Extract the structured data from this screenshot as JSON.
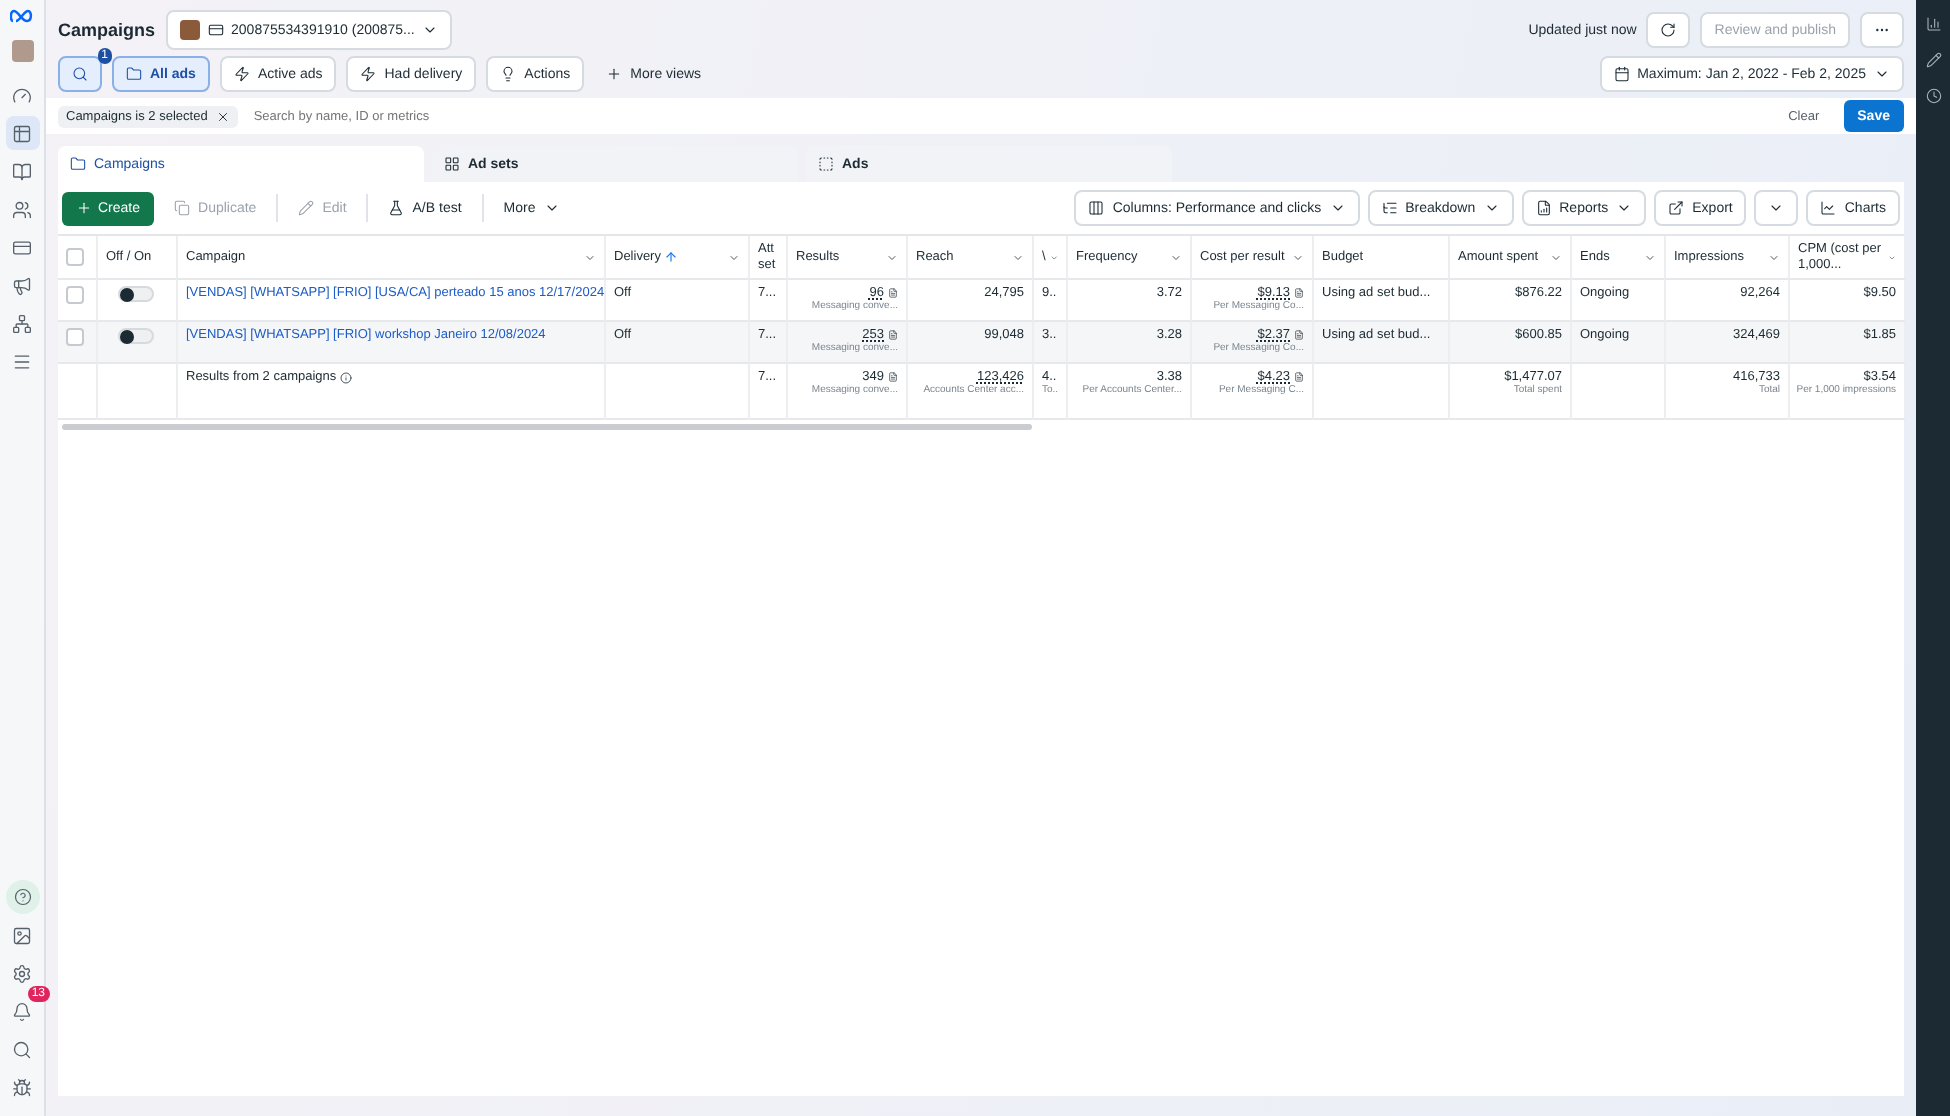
{
  "nav": {
    "items": [
      {
        "selected": false
      },
      {
        "selected": true
      },
      {
        "selected": false
      },
      {
        "selected": false
      },
      {
        "selected": false
      },
      {
        "selected": false
      },
      {
        "selected": false
      },
      {
        "selected": false
      }
    ],
    "notification_count": "13"
  },
  "header": {
    "title": "Campaigns",
    "account": "200875534391910 (200875...",
    "updated": "Updated just now",
    "review_button": "Review and publish",
    "date_range": "Maximum: Jan 2, 2022 - Feb 2, 2025"
  },
  "views": {
    "search_badge": "1",
    "items": [
      {
        "label": "All ads",
        "selected": true
      },
      {
        "label": "Active ads",
        "selected": false
      },
      {
        "label": "Had delivery",
        "selected": false
      },
      {
        "label": "Actions",
        "selected": false
      }
    ],
    "more_views": "More views"
  },
  "filter": {
    "chip": "Campaigns is 2 selected",
    "placeholder": "Search by name, ID or metrics",
    "clear": "Clear",
    "save": "Save"
  },
  "level_tabs": [
    {
      "label": "Campaigns",
      "selected": true
    },
    {
      "label": "Ad sets",
      "selected": false
    },
    {
      "label": "Ads",
      "selected": false
    }
  ],
  "toolbar": {
    "create": "Create",
    "duplicate": {
      "label": "Duplicate",
      "disabled": true
    },
    "edit": {
      "label": "Edit",
      "disabled": true
    },
    "ab_test": "A/B test",
    "more": "More",
    "columns": "Columns: Performance and clicks",
    "breakdown": "Breakdown",
    "reports": "Reports",
    "export": "Export",
    "charts": "Charts"
  },
  "table": {
    "columns": [
      {
        "kind": "select",
        "checked": false
      },
      {
        "label": "Off / On"
      },
      {
        "label": "Campaign",
        "menu": true
      },
      {
        "label": "Delivery",
        "sorted": true,
        "menu": true
      },
      {
        "label": "Att set"
      },
      {
        "label": "Results",
        "menu": true
      },
      {
        "label": "Reach",
        "menu": true
      },
      {
        "label": "\\",
        "menu": true
      },
      {
        "label": "Frequency",
        "menu": true
      },
      {
        "label": "Cost per result",
        "menu": true
      },
      {
        "label": "Budget"
      },
      {
        "label": "Amount spent",
        "menu": true
      },
      {
        "label": "Ends",
        "menu": true
      },
      {
        "label": "Impressions",
        "menu": true
      },
      {
        "label": "CPM (cost per 1,000...",
        "menu": true
      }
    ],
    "rows": [
      {
        "cells": [
          {
            "kind": "select",
            "checked": false
          },
          {
            "kind": "toggle",
            "on": false
          },
          {
            "kind": "link",
            "text": "[VENDAS] [WHATSAPP] [FRIO] [USA/CA] perteado 15 anos 12/17/2024"
          },
          {
            "text": "Off"
          },
          {
            "text": "7..."
          },
          {
            "text": "96",
            "sub": "Messaging conve...",
            "underlined": true,
            "note": true
          },
          {
            "text": "24,795"
          },
          {
            "text": "9.."
          },
          {
            "text": "3.72"
          },
          {
            "text": "$9.13",
            "sub": "Per Messaging Co...",
            "underlined": true,
            "note": true
          },
          {
            "text": "Using ad set bud..."
          },
          {
            "text": "$876.22"
          },
          {
            "text": "Ongoing"
          },
          {
            "text": "92,264"
          },
          {
            "text": "$9.50"
          }
        ]
      },
      {
        "cells": [
          {
            "kind": "select",
            "checked": false
          },
          {
            "kind": "toggle",
            "on": false
          },
          {
            "kind": "link",
            "text": "[VENDAS] [WHATSAPP] [FRIO] workshop Janeiro 12/08/2024"
          },
          {
            "text": "Off"
          },
          {
            "text": "7..."
          },
          {
            "text": "253",
            "sub": "Messaging conve...",
            "underlined": true,
            "note": true
          },
          {
            "text": "99,048"
          },
          {
            "text": "3.."
          },
          {
            "text": "3.28"
          },
          {
            "text": "$2.37",
            "sub": "Per Messaging Co...",
            "underlined": true,
            "note": true
          },
          {
            "text": "Using ad set bud..."
          },
          {
            "text": "$600.85"
          },
          {
            "text": "Ongoing"
          },
          {
            "text": "324,469"
          },
          {
            "text": "$1.85"
          }
        ]
      },
      {
        "cells": [
          {},
          {},
          {
            "kind": "summary",
            "text": "Results from 2 campaigns"
          },
          {},
          {
            "text": "7..."
          },
          {
            "text": "349",
            "sub": "Messaging conve...",
            "note": true
          },
          {
            "text": "123,426",
            "sub": "Accounts Center acc...",
            "underlined": true
          },
          {
            "text": "4..",
            "sub": "To.."
          },
          {
            "text": "3.38",
            "sub": "Per Accounts Center..."
          },
          {
            "text": "$4.23",
            "sub": "Per Messaging C...",
            "underlined": true,
            "note": true
          },
          {},
          {
            "text": "$1,477.07",
            "sub": "Total spent"
          },
          {},
          {
            "text": "416,733",
            "sub": "Total"
          },
          {
            "text": "$3.54",
            "sub": "Per 1,000 impressions"
          }
        ]
      }
    ]
  }
}
